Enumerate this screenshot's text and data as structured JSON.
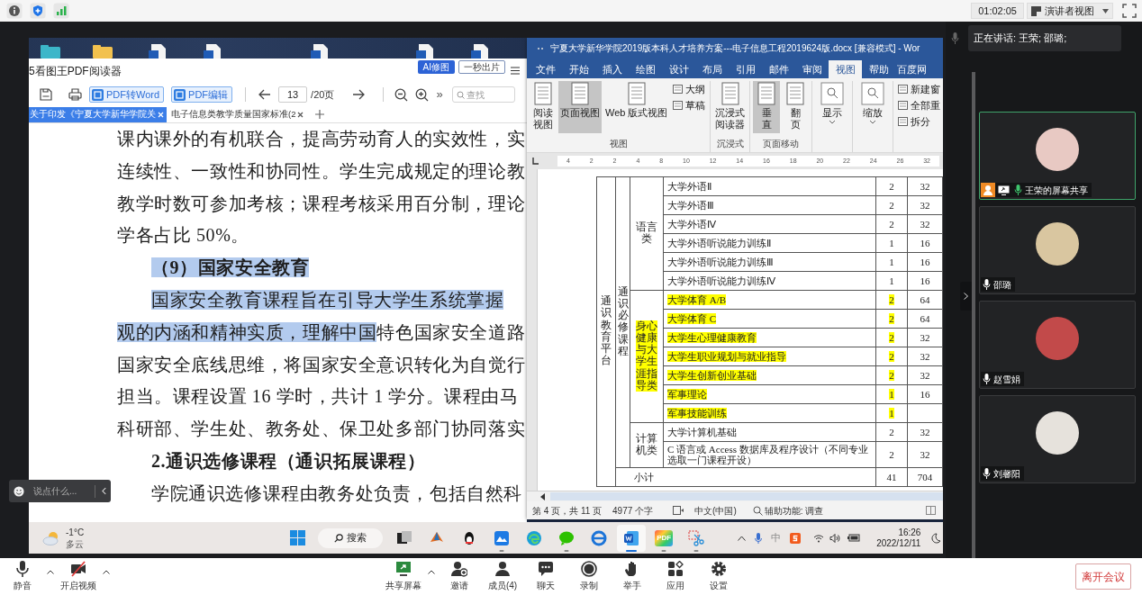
{
  "top_bar": {
    "timer": "01:02:05",
    "view_button": "演讲者视图"
  },
  "pdf_reader": {
    "title": "5看图王PDF阅读器",
    "header_buttons": [
      "AI修图",
      "一秒出片"
    ],
    "toolbar": {
      "convert_button": "PDF转Word",
      "edit_button": "PDF编辑",
      "page": "13",
      "page_total": "/20页",
      "more": "»",
      "search_placeholder": "查找"
    },
    "tabs": [
      {
        "label": "关于印发《宁夏大学新华学院关",
        "selected": true
      },
      {
        "label": "电子信息类教学质量国家标准(2",
        "selected": false
      }
    ],
    "lines": [
      {
        "indented": false,
        "heading": false,
        "segments": [
          {
            "text": "课内课外的有机联合，提高劳动育人的实效性，实",
            "highlighted": false
          }
        ]
      },
      {
        "indented": false,
        "heading": false,
        "segments": [
          {
            "text": "连续性、一致性和协同性。学生完成规定的理论教",
            "highlighted": false
          }
        ]
      },
      {
        "indented": false,
        "heading": false,
        "segments": [
          {
            "text": "教学时数可参加考核；课程考核采用百分制，理论",
            "highlighted": false
          }
        ]
      },
      {
        "indented": false,
        "heading": false,
        "segments": [
          {
            "text": "学各占比 50%。",
            "highlighted": false
          }
        ]
      },
      {
        "indented": true,
        "heading": true,
        "segments": [
          {
            "text": "（9）国家安全教育",
            "highlighted": true
          }
        ]
      },
      {
        "indented": true,
        "heading": false,
        "segments": [
          {
            "text": "国家安全教育课程旨在引导大学生系统掌握",
            "highlighted": true
          }
        ]
      },
      {
        "indented": false,
        "heading": false,
        "segments": [
          {
            "text": "观的内涵和精神实质，理解中国",
            "highlighted": true
          },
          {
            "text": "特色国家安全道路",
            "highlighted": false
          }
        ]
      },
      {
        "indented": false,
        "heading": false,
        "segments": [
          {
            "text": "国家安全底线思维，将国家安全意识转化为自觉行",
            "highlighted": false
          }
        ]
      },
      {
        "indented": false,
        "heading": false,
        "segments": [
          {
            "text": "担当。课程设置 16 学时，共计 1 学分。课程由马",
            "highlighted": false
          }
        ]
      },
      {
        "indented": false,
        "heading": false,
        "segments": [
          {
            "text": "科研部、学生处、教务处、保卫处多部门协同落实",
            "highlighted": false
          }
        ]
      },
      {
        "indented": true,
        "heading": true,
        "segments": [
          {
            "text": "2.通识选修课程（通识拓展课程）",
            "highlighted": false
          }
        ]
      },
      {
        "indented": true,
        "heading": false,
        "segments": [
          {
            "text": "学院通识选修课程由教务处负责，包括自然科",
            "highlighted": false
          }
        ]
      }
    ]
  },
  "word": {
    "title": "宁夏大学新华学院2019版本科人才培养方案---电子信息工程2019624版.docx [兼容模式] - Wor",
    "tabs": [
      {
        "label": "文件",
        "selected": false
      },
      {
        "label": "开始",
        "selected": false
      },
      {
        "label": "插入",
        "selected": false
      },
      {
        "label": "绘图",
        "selected": false
      },
      {
        "label": "设计",
        "selected": false
      },
      {
        "label": "布局",
        "selected": false
      },
      {
        "label": "引用",
        "selected": false
      },
      {
        "label": "邮件",
        "selected": false
      },
      {
        "label": "审阅",
        "selected": false
      },
      {
        "label": "视图",
        "selected": true
      },
      {
        "label": "帮助",
        "selected": false
      },
      {
        "label": "百度网",
        "selected": false
      }
    ],
    "ribbon": [
      {
        "label": "视图",
        "buttons": [
          {
            "label": "阅读视图",
            "kind": "stacked",
            "selected": false
          },
          {
            "label": "页面视图",
            "kind": "large",
            "selected": true
          },
          {
            "label": "Web 版式视图",
            "kind": "large",
            "selected": false
          },
          {
            "label": "大纲",
            "kind": "small",
            "selected": false
          },
          {
            "label": "草稿",
            "kind": "small",
            "selected": false
          }
        ]
      },
      {
        "label": "沉浸式",
        "buttons": [
          {
            "label": "沉浸式阅读器",
            "kind": "stacked",
            "selected": false
          }
        ]
      },
      {
        "label": "页面移动",
        "buttons": [
          {
            "label": "垂直",
            "kind": "stacked",
            "selected": true
          },
          {
            "label": "翻页",
            "kind": "stacked",
            "selected": false
          }
        ]
      },
      {
        "buttons": [
          {
            "label": "显示",
            "kind": "dropdown",
            "selected": false
          }
        ]
      },
      {
        "buttons": [
          {
            "label": "缩放",
            "kind": "dropdown",
            "selected": false
          }
        ]
      },
      {
        "buttons": [
          {
            "label": "新建窗",
            "kind": "small",
            "selected": false
          },
          {
            "label": "全部重",
            "kind": "small",
            "selected": false
          },
          {
            "label": "拆分",
            "kind": "small",
            "selected": false
          }
        ]
      }
    ],
    "ruler_numbers": [
      "4",
      "2",
      "2",
      "4",
      "8",
      "10",
      "12",
      "14",
      "16",
      "18",
      "20",
      "22",
      "24",
      "26",
      "32"
    ],
    "table": {
      "platform": "通识教育平台",
      "module": "通识必修课程",
      "groups": [
        {
          "category": "语言类",
          "highlighted": false,
          "courses": [
            {
              "name": "大学外语Ⅱ",
              "credits": "2",
              "hours": "32",
              "highlighted": false
            },
            {
              "name": "大学外语Ⅲ",
              "credits": "2",
              "hours": "32",
              "highlighted": false
            },
            {
              "name": "大学外语Ⅳ",
              "credits": "2",
              "hours": "32",
              "highlighted": false
            },
            {
              "name": "大学外语听说能力训练Ⅱ",
              "credits": "1",
              "hours": "16",
              "highlighted": false
            },
            {
              "name": "大学外语听说能力训练Ⅲ",
              "credits": "1",
              "hours": "16",
              "highlighted": false
            },
            {
              "name": "大学外语听说能力训练Ⅳ",
              "credits": "1",
              "hours": "16",
              "highlighted": false
            }
          ]
        },
        {
          "category": "身心健康与大学生涯指导类",
          "highlighted": true,
          "courses": [
            {
              "name": "大学体育 A/B",
              "credits": "2",
              "hours": "64",
              "highlighted": true
            },
            {
              "name": "大学体育 C",
              "credits": "2",
              "hours": "64",
              "highlighted": true
            },
            {
              "name": "大学生心理健康教育",
              "credits": "2",
              "hours": "32",
              "highlighted": true
            },
            {
              "name": "大学生职业规划与就业指导",
              "credits": "2",
              "hours": "32",
              "highlighted": true
            },
            {
              "name": "大学生创新创业基础",
              "credits": "2",
              "hours": "32",
              "highlighted": true
            },
            {
              "name": "军事理论",
              "credits": "1",
              "hours": "16",
              "highlighted": true
            },
            {
              "name": "军事技能训练",
              "credits": "1",
              "highlighted": true
            }
          ]
        },
        {
          "category": "计算机类",
          "highlighted": false,
          "courses": [
            {
              "name": "大学计算机基础",
              "credits": "2",
              "hours": "32",
              "highlighted": false
            },
            {
              "name": "C 语言或 Access 数据库及程序设计（不同专业选取一门课程开设）",
              "credits": "2",
              "hours": "32",
              "highlighted": false
            }
          ]
        }
      ],
      "subtotal": {
        "label": "小计",
        "credits": "41",
        "hours": "704"
      }
    },
    "status": {
      "page": "第 4 页，共 11 页",
      "words": "4977 个字",
      "language": "中文(中国)",
      "accessibility": "辅助功能: 调查"
    }
  },
  "taskbar": {
    "temperature": "-1°C",
    "weather": "多云",
    "search": "搜索",
    "apps": [
      {
        "kind": "taskview",
        "running": false,
        "active": false
      },
      {
        "kind": "matlab",
        "running": false,
        "active": false
      },
      {
        "kind": "penguin",
        "running": false,
        "active": false
      },
      {
        "kind": "cloud",
        "running": true,
        "active": false
      },
      {
        "kind": "browser",
        "running": false,
        "active": false
      },
      {
        "kind": "chat",
        "running": true,
        "active": false
      },
      {
        "kind": "browser_old",
        "running": false,
        "active": false
      },
      {
        "kind": "word",
        "running": true,
        "active": true
      },
      {
        "kind": "pdf",
        "label": "PDF",
        "running": true,
        "active": false
      },
      {
        "kind": "snip",
        "running": true,
        "active": false
      }
    ],
    "ime": "中",
    "time": "16:26",
    "date": "2022/12/11"
  },
  "chat": {
    "placeholder": "说点什么..."
  },
  "speaking": "正在讲话: 王荣; 邵璐;",
  "participants": [
    {
      "name": "王荣的屏幕共享",
      "active": true,
      "sharing": true
    },
    {
      "name": "邵璐",
      "active": false,
      "sharing": false
    },
    {
      "name": "赵雪娟",
      "active": false,
      "sharing": false
    },
    {
      "name": "刘馨阳",
      "active": false,
      "sharing": false
    }
  ],
  "left_controls": [
    {
      "label": "静音",
      "kind": "mic",
      "menu": true
    },
    {
      "label": "开启视频",
      "kind": "video_off",
      "menu": true
    }
  ],
  "center_controls": [
    {
      "label": "共享屏幕",
      "kind": "share",
      "menu": true
    },
    {
      "label": "邀请",
      "kind": "invite"
    },
    {
      "label": "成员(4)",
      "kind": "members"
    },
    {
      "label": "聊天",
      "kind": "chat"
    },
    {
      "label": "录制",
      "kind": "record"
    },
    {
      "label": "举手",
      "kind": "hand"
    },
    {
      "label": "应用",
      "kind": "apps"
    },
    {
      "label": "设置",
      "kind": "settings"
    }
  ],
  "leave_button": "离开会议"
}
